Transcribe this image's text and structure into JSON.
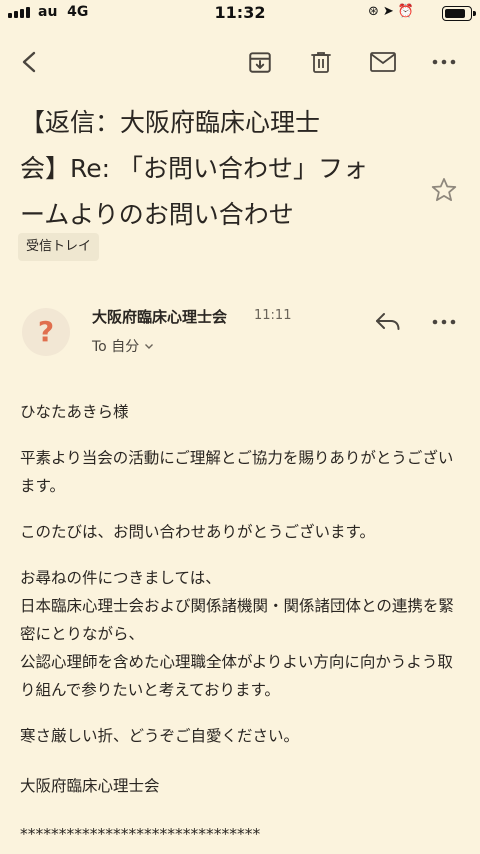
{
  "status_bar": {
    "carrier": "au",
    "network": "4G",
    "time": "11:32",
    "battery_level": 0.85
  },
  "toolbar": {
    "back_icon": "chevron-left-icon",
    "archive_icon": "archive-icon",
    "delete_icon": "trash-icon",
    "mark_unread_icon": "mail-icon",
    "more_icon": "more-horizontal-icon"
  },
  "email": {
    "subject_line1": "【返信：大阪府臨床心理士",
    "subject_line2": "会】Re: 「お問い合わせ」フォ",
    "subject_line3": "ームよりのお問い合わせ",
    "label": "受信トレイ",
    "sender_initial": "?",
    "sender": "大阪府臨床心理士会",
    "time": "11:11",
    "to": "To 自分",
    "body": {
      "greeting": "ひなたあきら様",
      "p1": "平素より当会の活動にご理解とご協力を賜りありがとうございます。",
      "p2": "このたびは、お問い合わせありがとうございます。",
      "p3_l1": "お尋ねの件につきましては、",
      "p3_l2": "日本臨床心理士会および関係諸機関・関係諸団体との連携を緊密にとりながら、",
      "p3_l3": "公認心理師を含めた心理職全体がよりよい方向に向かうよう取り組んで参りたいと考えております。",
      "p4": "寒さ厳しい折、どうぞご自愛ください。",
      "signature": "大阪府臨床心理士会",
      "separator": "*******************************"
    }
  },
  "colors": {
    "background": "#fbf3dd",
    "avatar_bg": "#f2e7d4",
    "avatar_fg": "#e06f4e"
  }
}
